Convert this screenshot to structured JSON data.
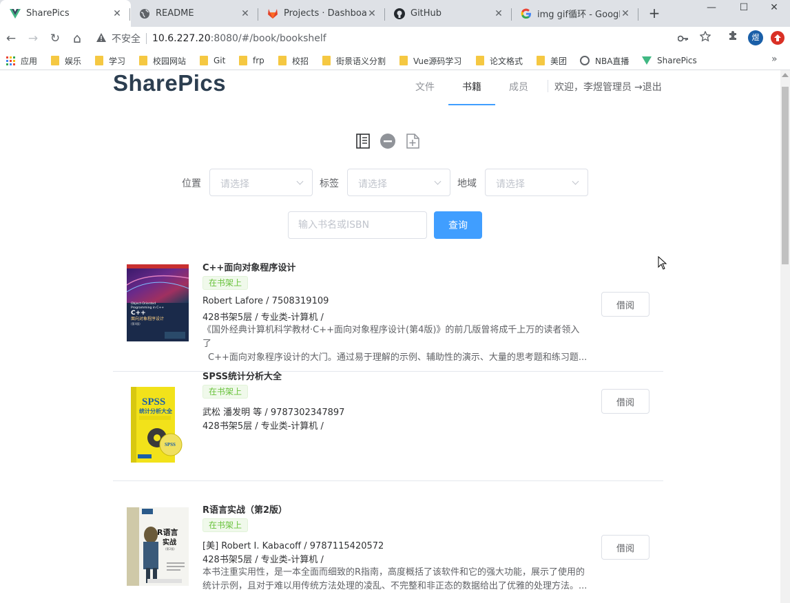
{
  "browser": {
    "tabs": [
      {
        "title": "SharePics",
        "icon": "vue-icon"
      },
      {
        "title": "README",
        "icon": "globe-icon"
      },
      {
        "title": "Projects · Dashboard",
        "icon": "gitlab-icon"
      },
      {
        "title": "GitHub",
        "icon": "github-icon"
      },
      {
        "title": "img gif循环 - Google",
        "icon": "google-icon"
      }
    ],
    "close_glyph": "✕",
    "new_tab_glyph": "+",
    "window": {
      "minimize": "—",
      "maximize": "☐",
      "close": "✕"
    },
    "nav": {
      "back": "←",
      "forward": "→",
      "reload": "↻",
      "home": "⌂"
    },
    "address": {
      "security_label": "不安全",
      "host": "10.6.227.20",
      "path": ":8080/#/book/bookshelf"
    },
    "avatar_text": "煜",
    "bookmarks": [
      {
        "label": "应用",
        "icon": "apps-icon"
      },
      {
        "label": "娱乐",
        "icon": "folder-icon"
      },
      {
        "label": "学习",
        "icon": "folder-icon"
      },
      {
        "label": "校园网站",
        "icon": "folder-icon"
      },
      {
        "label": "Git",
        "icon": "folder-icon"
      },
      {
        "label": "frp",
        "icon": "folder-icon"
      },
      {
        "label": "校招",
        "icon": "folder-icon"
      },
      {
        "label": "街景语义分割",
        "icon": "folder-icon"
      },
      {
        "label": "Vue源码学习",
        "icon": "folder-icon"
      },
      {
        "label": "论文格式",
        "icon": "folder-icon"
      },
      {
        "label": "美团",
        "icon": "folder-icon"
      },
      {
        "label": "NBA直播",
        "icon": "globe-icon"
      },
      {
        "label": "SharePics",
        "icon": "vue-icon"
      }
    ]
  },
  "header": {
    "brand": "SharePics",
    "menu": [
      {
        "label": "文件",
        "active": false
      },
      {
        "label": "书籍",
        "active": true
      },
      {
        "label": "成员",
        "active": false
      }
    ],
    "welcome": "欢迎，李煜管理员",
    "logout": "→退出",
    "accent_color": "#409eff"
  },
  "toolbar_icons": [
    "list-view-icon",
    "remove-icon",
    "add-book-icon"
  ],
  "filters": [
    {
      "label": "位置",
      "placeholder": "请选择"
    },
    {
      "label": "标签",
      "placeholder": "请选择"
    },
    {
      "label": "地域",
      "placeholder": "请选择"
    }
  ],
  "search": {
    "placeholder": "输入书名或ISBN",
    "button": "查询"
  },
  "books": [
    {
      "title": "C++面向对象程序设计",
      "status": "在书架上",
      "author_isbn": "Robert Lafore / 7508319109",
      "location": "428书架5层 / 专业类-计算机 /",
      "desc_line1": "《国外经典计算机科学教材·C++面向对象程序设计(第4版)》的前几版曾将成千上万的读者领入了",
      "desc_line2": "C++面向对象程序设计的大门。通过易于理解的示例、辅助性的演示、大量的思考题和练习题...",
      "borrow": "借阅",
      "cover_lines": [
        "Object-Oriented",
        "Programming in C++",
        "C++",
        "面向对象程序设计",
        "(第4版)"
      ]
    },
    {
      "title": "SPSS统计分析大全",
      "status": "在书架上",
      "author_isbn": "武松 潘发明 等 / 9787302347897",
      "location": "428书架5层 / 专业类-计算机 /",
      "desc_line1": "",
      "desc_line2": "",
      "borrow": "借阅",
      "cover_lines": [
        "SPSS",
        "统计分析大全"
      ]
    },
    {
      "title": "R语言实战（第2版）",
      "status": "在书架上",
      "author_isbn": "[美] Robert I. Kabacoff / 9787115420572",
      "location": "428书架5层 / 专业类-计算机 /",
      "desc_line1": "本书注重实用性，是一本全面而细致的R指南，高度概括了该软件和它的强大功能，展示了使用的",
      "desc_line2": "统计示例，且对于难以用传统方法处理的凌乱、不完整和非正态的数据给出了优雅的处理方法。...",
      "borrow": "借阅",
      "cover_lines": [
        "R语言",
        "实战",
        "(第2版)"
      ]
    }
  ]
}
